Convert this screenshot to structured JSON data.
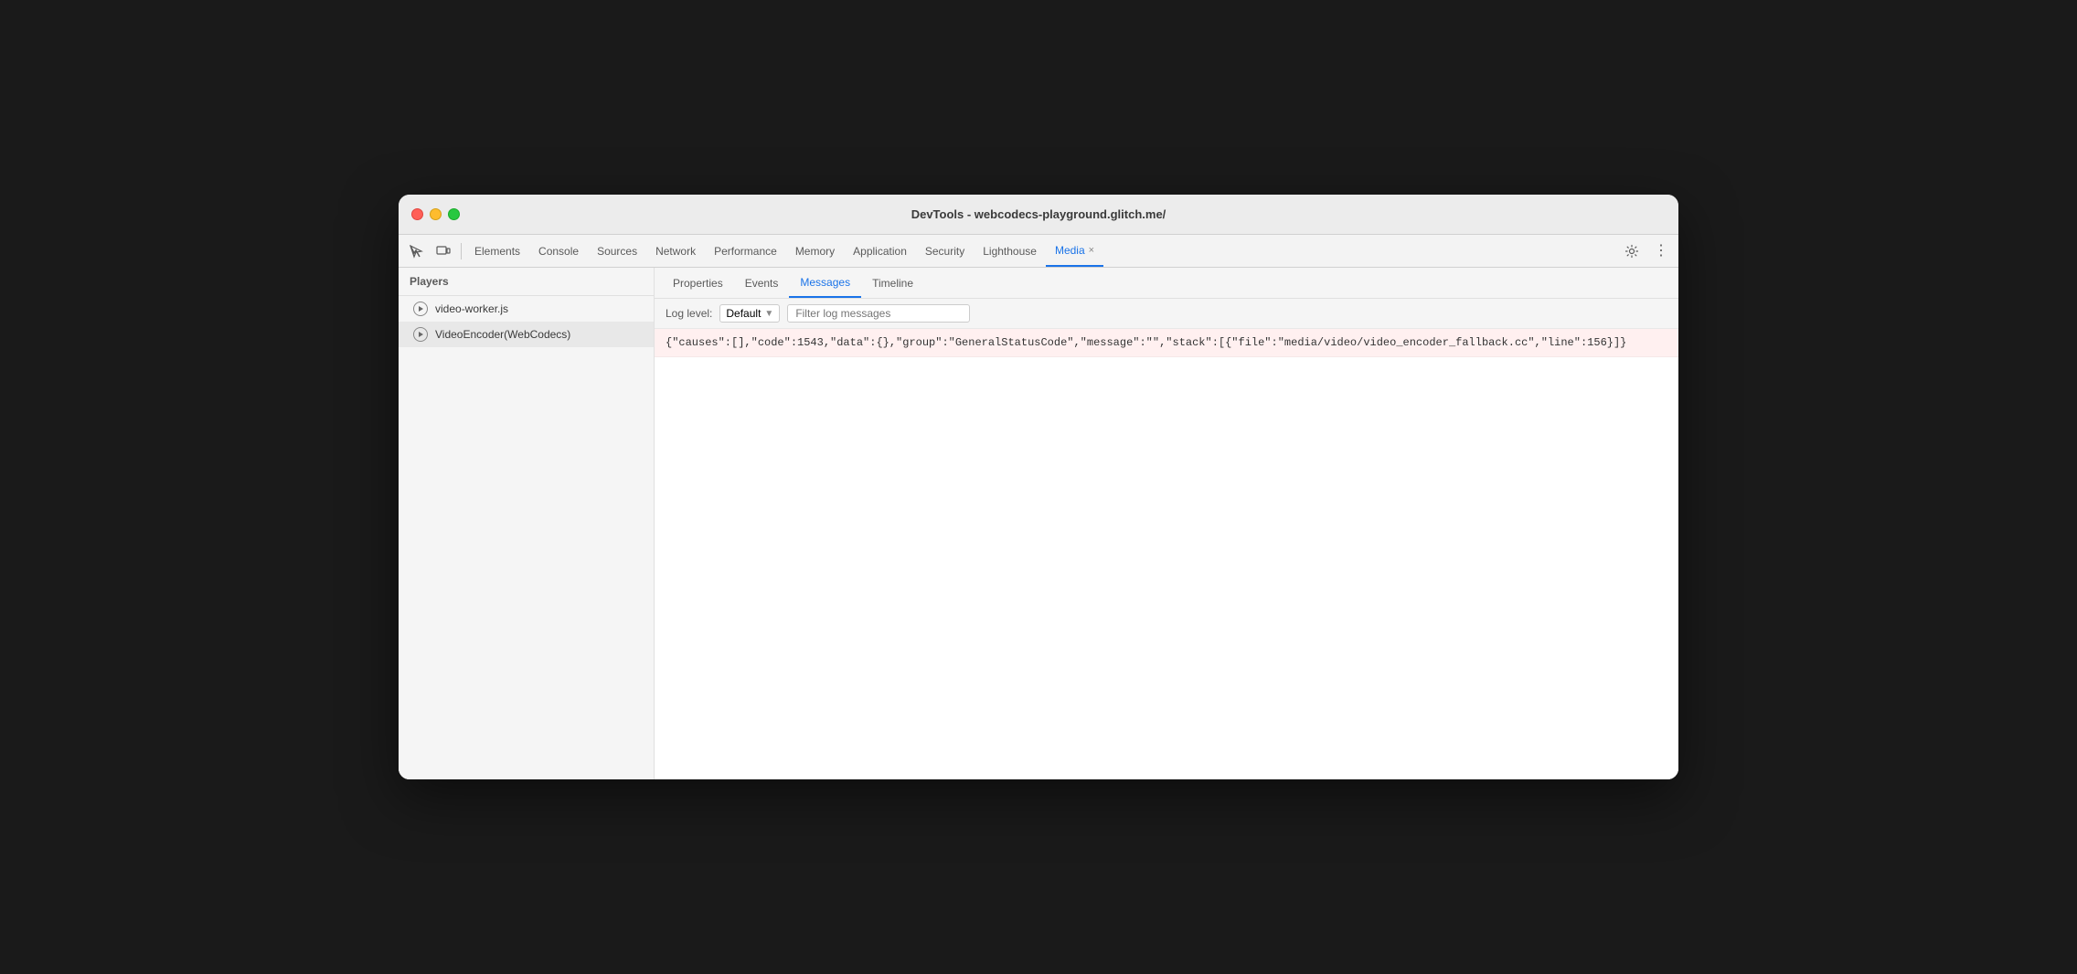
{
  "window": {
    "title": "DevTools - webcodecs-playground.glitch.me/"
  },
  "traffic_lights": {
    "red_label": "close",
    "yellow_label": "minimize",
    "green_label": "maximize"
  },
  "toolbar": {
    "inspect_icon": "⊡",
    "device_icon": "▭",
    "tabs": [
      {
        "id": "elements",
        "label": "Elements",
        "active": false
      },
      {
        "id": "console",
        "label": "Console",
        "active": false
      },
      {
        "id": "sources",
        "label": "Sources",
        "active": false
      },
      {
        "id": "network",
        "label": "Network",
        "active": false
      },
      {
        "id": "performance",
        "label": "Performance",
        "active": false
      },
      {
        "id": "memory",
        "label": "Memory",
        "active": false
      },
      {
        "id": "application",
        "label": "Application",
        "active": false
      },
      {
        "id": "security",
        "label": "Security",
        "active": false
      },
      {
        "id": "lighthouse",
        "label": "Lighthouse",
        "active": false
      },
      {
        "id": "media",
        "label": "Media",
        "active": true,
        "closeable": true
      }
    ],
    "settings_icon": "⚙",
    "more_icon": "⋮"
  },
  "sidebar": {
    "header": "Players",
    "items": [
      {
        "id": "video-worker",
        "label": "video-worker.js",
        "active": false
      },
      {
        "id": "video-encoder",
        "label": "VideoEncoder(WebCodecs)",
        "active": true
      }
    ]
  },
  "panel": {
    "tabs": [
      {
        "id": "properties",
        "label": "Properties",
        "active": false
      },
      {
        "id": "events",
        "label": "Events",
        "active": false
      },
      {
        "id": "messages",
        "label": "Messages",
        "active": true
      },
      {
        "id": "timeline",
        "label": "Timeline",
        "active": false
      }
    ],
    "log_level": {
      "label": "Log level:",
      "value": "Default",
      "dropdown_icon": "▼"
    },
    "filter": {
      "placeholder": "Filter log messages"
    },
    "messages": [
      {
        "id": "msg-1",
        "type": "error",
        "text": "{\"causes\":[],\"code\":1543,\"data\":{},\"group\":\"GeneralStatusCode\",\"message\":\"\",\"stack\":[{\"file\":\"media/video/video_encoder_fallback.cc\",\"line\":156}]}"
      }
    ]
  }
}
